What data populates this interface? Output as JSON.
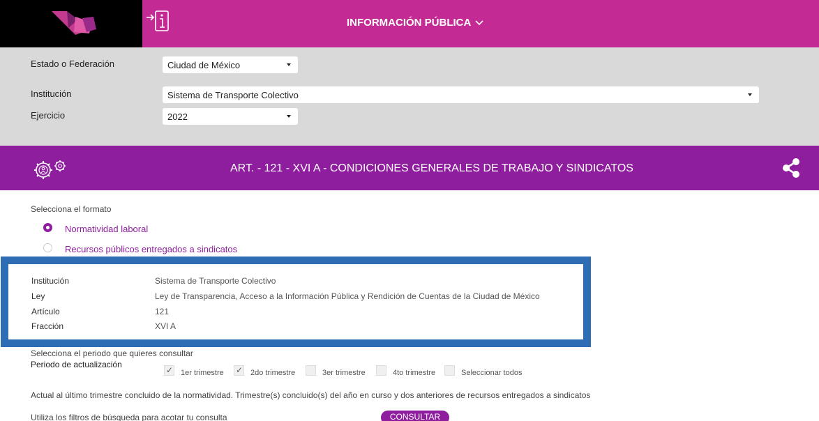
{
  "header": {
    "menu_title": "INFORMACIÓN PÚBLICA",
    "menu_icon": "chevron-down-icon",
    "colors": {
      "header": "#c42a93",
      "article_bar": "#8e1e9e",
      "highlight_border": "#2e6db4"
    }
  },
  "filters": {
    "estado": {
      "label": "Estado o Federación",
      "value": "Ciudad de México"
    },
    "institucion": {
      "label": "Institución",
      "value": "Sistema de Transporte Colectivo"
    },
    "ejercicio": {
      "label": "Ejercicio",
      "value": "2022"
    }
  },
  "article": {
    "title": "ART. - 121 - XVI A - CONDICIONES GENERALES DE TRABAJO Y SINDICATOS"
  },
  "format": {
    "label": "Selecciona el formato",
    "options": [
      {
        "label": "Normatividad laboral",
        "selected": true
      },
      {
        "label": "Recursos públicos entregados a sindicatos",
        "selected": false
      }
    ]
  },
  "details": [
    {
      "key": "Institución",
      "value": "Sistema de Transporte Colectivo"
    },
    {
      "key": "Ley",
      "value": "Ley de Transparencia, Acceso a la Información Pública y Rendición de Cuentas de la Ciudad de México"
    },
    {
      "key": "Artículo",
      "value": "121"
    },
    {
      "key": "Fracción",
      "value": "XVI A"
    }
  ],
  "period": {
    "prompt": "Selecciona el periodo que quieres consultar",
    "label": "Periodo de actualización",
    "options": [
      {
        "label": "1er trimestre",
        "checked": true
      },
      {
        "label": "2do trimestre",
        "checked": true
      },
      {
        "label": "3er trimestre",
        "checked": false
      },
      {
        "label": "4to trimestre",
        "checked": false
      },
      {
        "label": "Seleccionar todos",
        "checked": false
      }
    ],
    "note": "Actual al último trimestre concluido de la normatividad. Trimestre(s) concluido(s) del año en curso y dos anteriores de recursos entregados a sindicatos"
  },
  "search": {
    "hint": "Utiliza los filtros de búsqueda para acotar tu consulta",
    "button": "CONSULTAR"
  }
}
